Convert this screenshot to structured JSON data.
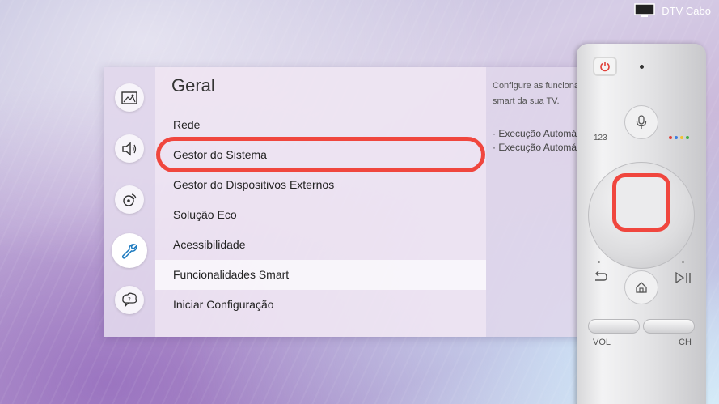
{
  "source": {
    "label": "DTV Cabo",
    "icon": "tv-icon"
  },
  "sidebar": {
    "categories": [
      {
        "icon": "picture-icon",
        "active": false
      },
      {
        "icon": "sound-icon",
        "active": false
      },
      {
        "icon": "broadcast-icon",
        "active": false
      },
      {
        "icon": "wrench-icon",
        "active": true
      },
      {
        "icon": "support-icon",
        "active": false
      }
    ]
  },
  "menu": {
    "title": "Geral",
    "items": [
      {
        "label": "Rede",
        "selected": false
      },
      {
        "label": "Gestor do Sistema",
        "selected": false
      },
      {
        "label": "Gestor do Dispositivos Externos",
        "selected": false
      },
      {
        "label": "Solução Eco",
        "selected": false
      },
      {
        "label": "Acessibilidade",
        "selected": false
      },
      {
        "label": "Funcionalidades Smart",
        "selected": true
      },
      {
        "label": "Iniciar Configuração",
        "selected": false
      }
    ]
  },
  "info": {
    "line1": "Configure as funcionalidades",
    "line2": "smart da sua TV.",
    "bullet1": "· Execução Automática",
    "bullet2": "· Execução Automática"
  },
  "remote": {
    "label_123": "123",
    "vol_label": "VOL",
    "ch_label": "CH",
    "accent_color": "#f0463e",
    "color_dots": [
      "#e0413a",
      "#3b7de0",
      "#f1c232",
      "#44b04a"
    ]
  }
}
